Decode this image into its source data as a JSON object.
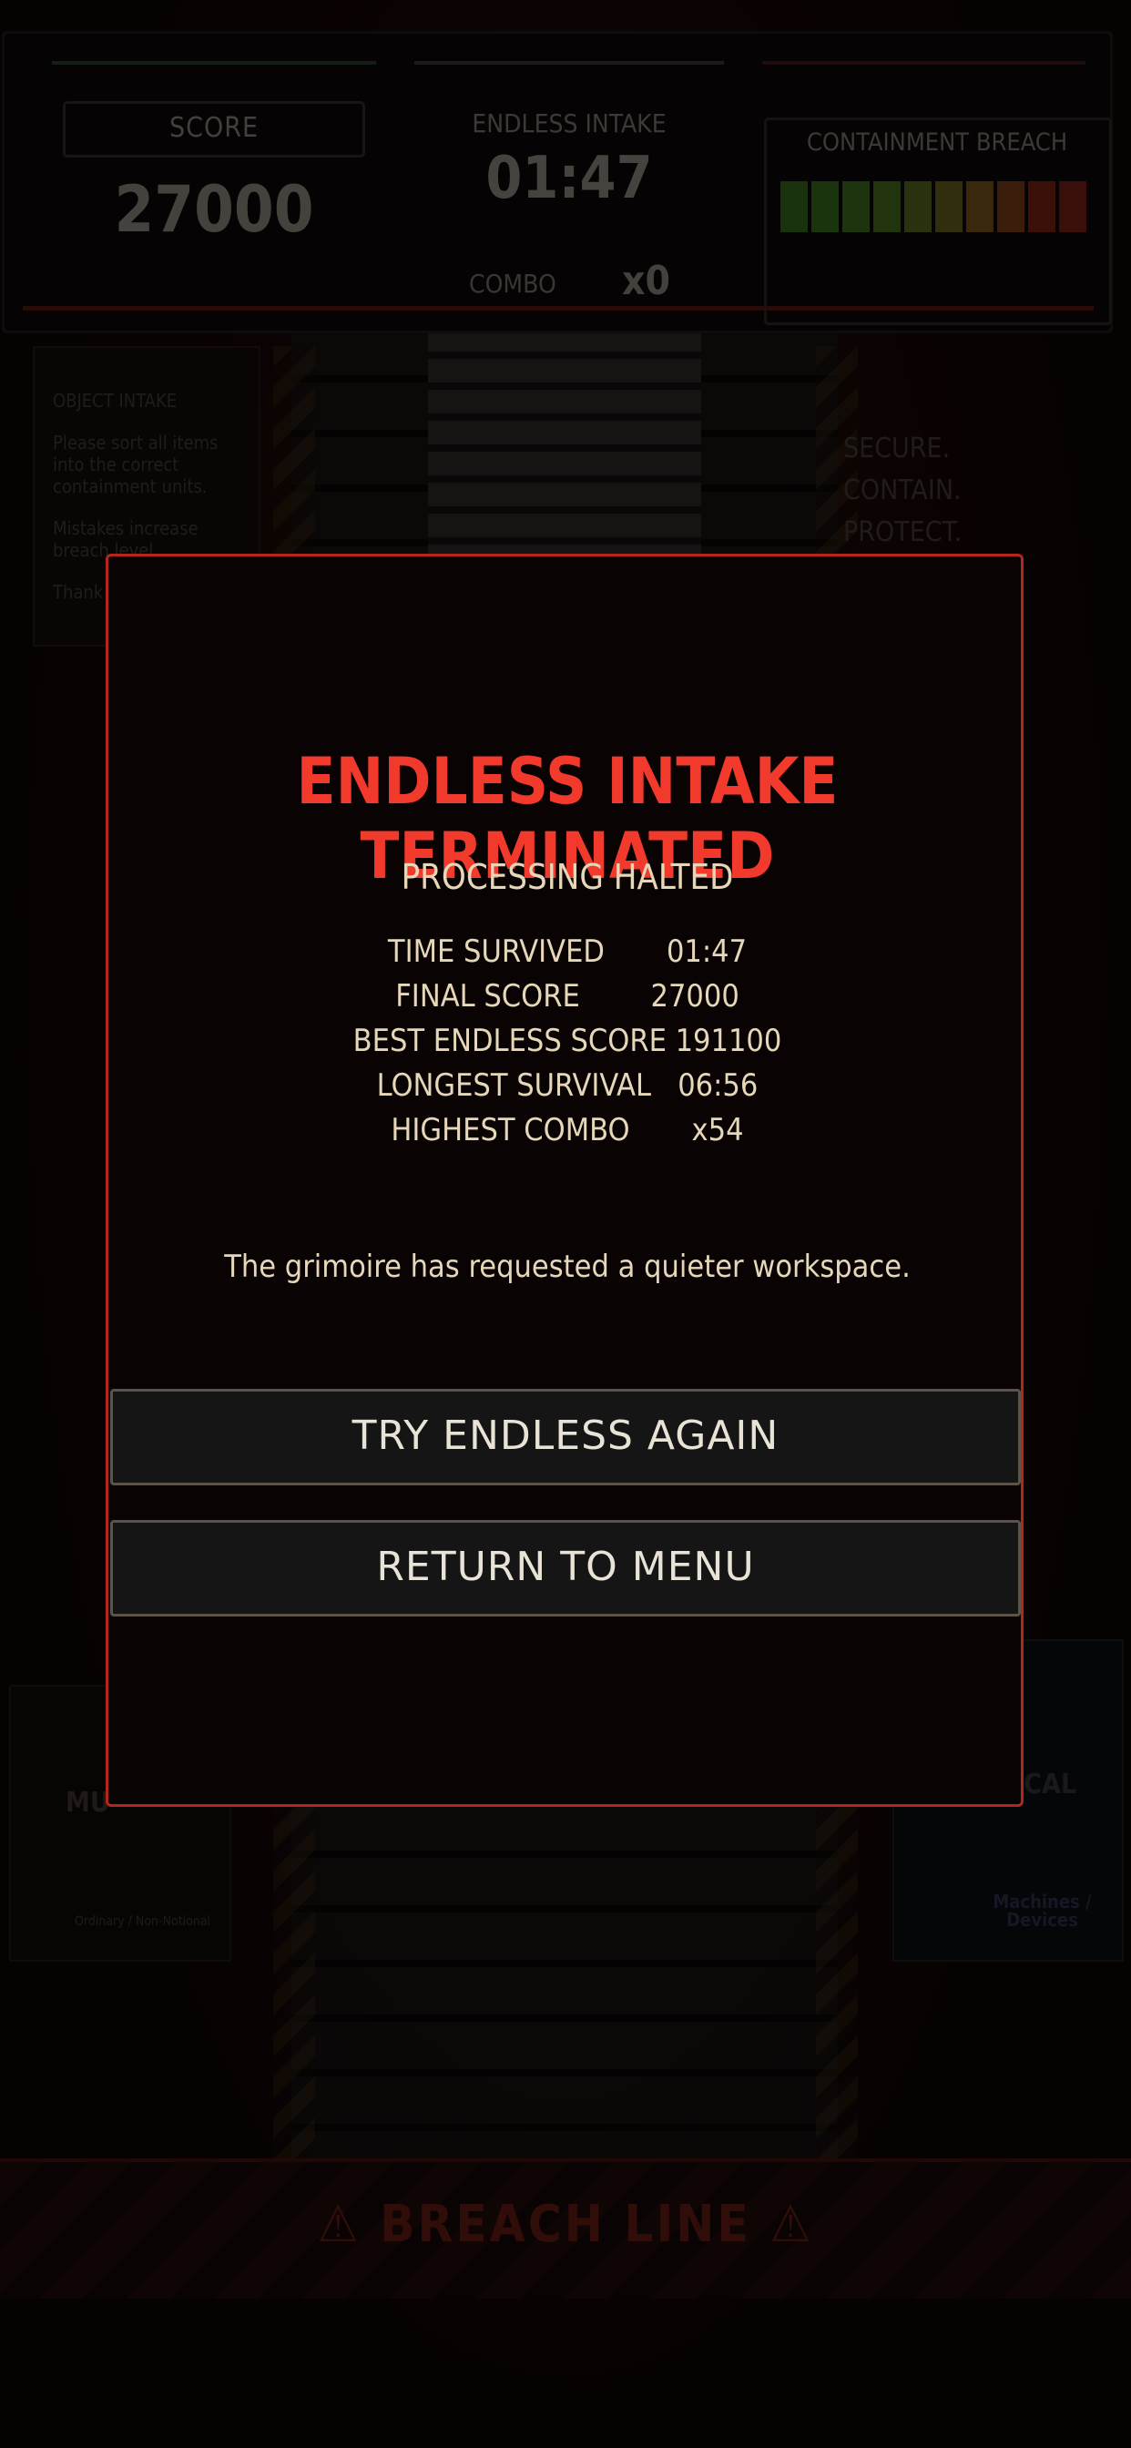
{
  "hud": {
    "score_label": "SCORE",
    "score_value": "27000",
    "mode_label": "ENDLESS INTAKE",
    "timer": "01:47",
    "combo_label": "COMBO",
    "combo_value": "x0",
    "breach_label": "CONTAINMENT BREACH",
    "breach_segment_colors": [
      "#2f5a18",
      "#325f1a",
      "#365f1b",
      "#3e5f1b",
      "#4d5a1a",
      "#5a5518",
      "#6a4a16",
      "#6a3814",
      "#6a1e12",
      "#6a1a14"
    ]
  },
  "background": {
    "poster_title": "OBJECT INTAKE",
    "poster_text_1": "Please sort all items into the correct containment units.",
    "poster_text_2": "Mistakes increase breach level.",
    "poster_text_3": "Thank",
    "motto_1": "SECURE.",
    "motto_2": "CONTAIN.",
    "motto_3": "PROTECT.",
    "bin_left_label": "MU",
    "bin_left_sub": "Ordinary / Non-Notional",
    "bin_right_label": "GICAL",
    "bin_right_sub": "Machines / Devices",
    "breach_line": "⚠ BREACH LINE ⚠"
  },
  "modal": {
    "title": "ENDLESS INTAKE TERMINATED",
    "subtitle": "PROCESSING HALTED",
    "stats": [
      "TIME SURVIVED       01:47",
      "FINAL SCORE        27000",
      "BEST ENDLESS SCORE 191100",
      "LONGEST SURVIVAL   06:56",
      "HIGHEST COMBO       x54"
    ],
    "flavor": "The grimoire has requested a quieter workspace.",
    "button_retry": "TRY ENDLESS AGAIN",
    "button_menu": "RETURN TO MENU"
  }
}
